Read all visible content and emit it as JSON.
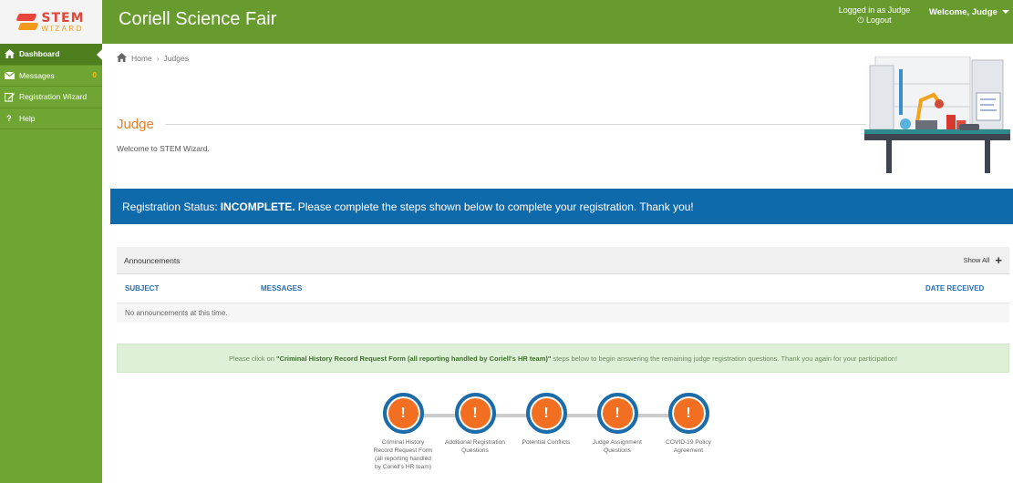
{
  "app": {
    "title": "Coriell Science Fair",
    "logo": {
      "line1": "STEM",
      "line2": "WIZARD"
    }
  },
  "header": {
    "logged_in_as": "Logged in as Judge",
    "logout_label": "Logout",
    "welcome": "Welcome, Judge"
  },
  "sidebar": {
    "items": [
      {
        "label": "Dashboard",
        "icon": "home-icon",
        "active": true
      },
      {
        "label": "Messages",
        "icon": "envelope-icon",
        "badge": "0"
      },
      {
        "label": "Registration Wizard",
        "icon": "edit-icon"
      },
      {
        "label": "Help",
        "icon": "question-icon"
      }
    ]
  },
  "breadcrumb": {
    "home": "Home",
    "current": "Judges"
  },
  "page": {
    "title": "Judge",
    "welcome": "Welcome to STEM Wizard."
  },
  "status": {
    "prefix": "Registration Status:",
    "state": "INCOMPLETE.",
    "message": "Please complete the steps shown below to complete your registration. Thank you!"
  },
  "announcements": {
    "title": "Announcements",
    "show_all": "Show All",
    "columns": {
      "subject": "SUBJECT",
      "messages": "MESSAGES",
      "date": "DATE RECEIVED"
    },
    "empty": "No announcements at this time."
  },
  "info_alert": {
    "before": "Please click on",
    "highlight": "\"Criminal History Record Request Form (all reporting handled by Coriell's HR team)\"",
    "after": "steps below to begin answering the remaining judge registration questions. Thank you again for your participation!"
  },
  "steps": [
    {
      "lines": [
        "Criminal History",
        "Record Request Form",
        "(all reporting handled",
        "by Coriell's HR team)"
      ],
      "icon": "exclamation-icon"
    },
    {
      "lines": [
        "Additional Registration",
        "Questions"
      ],
      "icon": "exclamation-icon"
    },
    {
      "lines": [
        "Potential Conflicts"
      ],
      "icon": "exclamation-icon"
    },
    {
      "lines": [
        "Judge Assignment",
        "Questions"
      ],
      "icon": "exclamation-icon"
    },
    {
      "lines": [
        "COVID-19 Policy",
        "Agreement"
      ],
      "icon": "exclamation-icon"
    }
  ],
  "colors": {
    "header_green": "#689b2e",
    "sidebar_green": "#6fa532",
    "title_orange": "#ef7d24",
    "banner_blue": "#0f6aab",
    "step_orange": "#f26f21",
    "link_blue": "#2a6db3"
  }
}
